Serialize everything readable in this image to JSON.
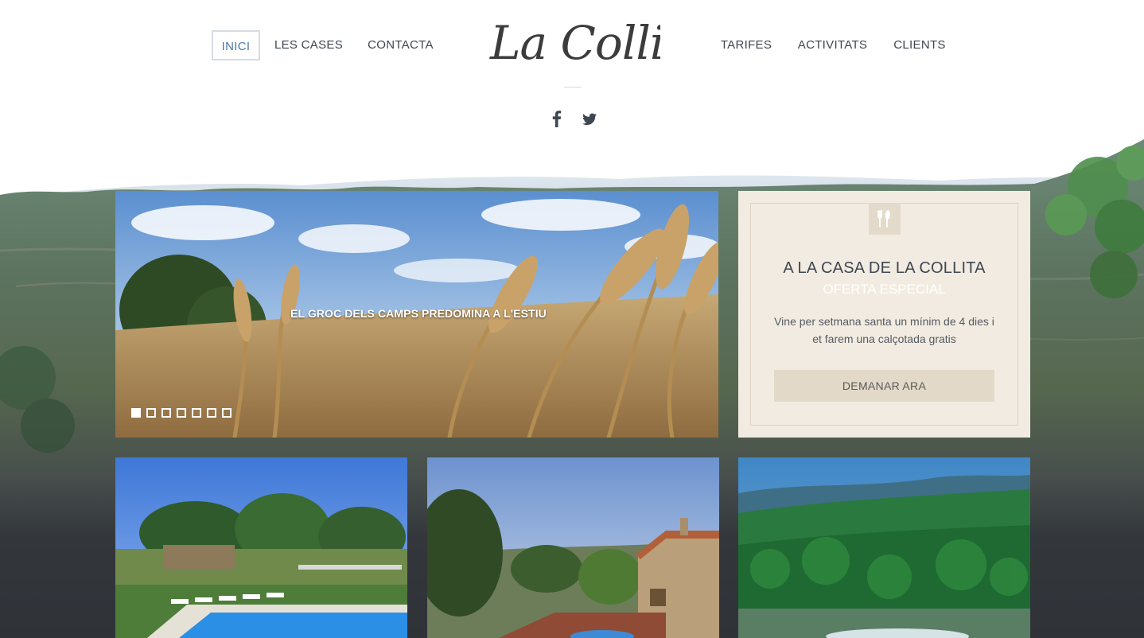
{
  "header": {
    "nav_left": [
      {
        "label": "INICI",
        "active": true
      },
      {
        "label": "LES CASES",
        "active": false
      },
      {
        "label": "CONTACTA",
        "active": false
      }
    ],
    "nav_right": [
      {
        "label": "TARIFES",
        "active": false
      },
      {
        "label": "ACTIVITATS",
        "active": false
      },
      {
        "label": "CLIENTS",
        "active": false
      }
    ],
    "logo_text": "La Collita",
    "social_icons": [
      "facebook-icon",
      "twitter-icon"
    ]
  },
  "hero": {
    "caption": "EL GROC DELS CAMPS PREDOMINA A L'ESTIU",
    "slide_count": 7,
    "active_slide": 1
  },
  "offer": {
    "icon": "cutlery-icon",
    "title": "A LA CASA DE LA COLLITA",
    "subtitle": "OFERTA ESPECIAL",
    "text_line1": "Vine per setmana santa un mínim de 4 dies i",
    "text_line2": "et farem una calçotada gratis",
    "button_label": "DEMANAR ARA"
  },
  "colors": {
    "nav_text": "#3e4652",
    "nav_active": "#4a7aa6",
    "offer_bg": "#f2ebe1",
    "offer_button": "#e3d9c8",
    "page_dark": "#32363c"
  }
}
